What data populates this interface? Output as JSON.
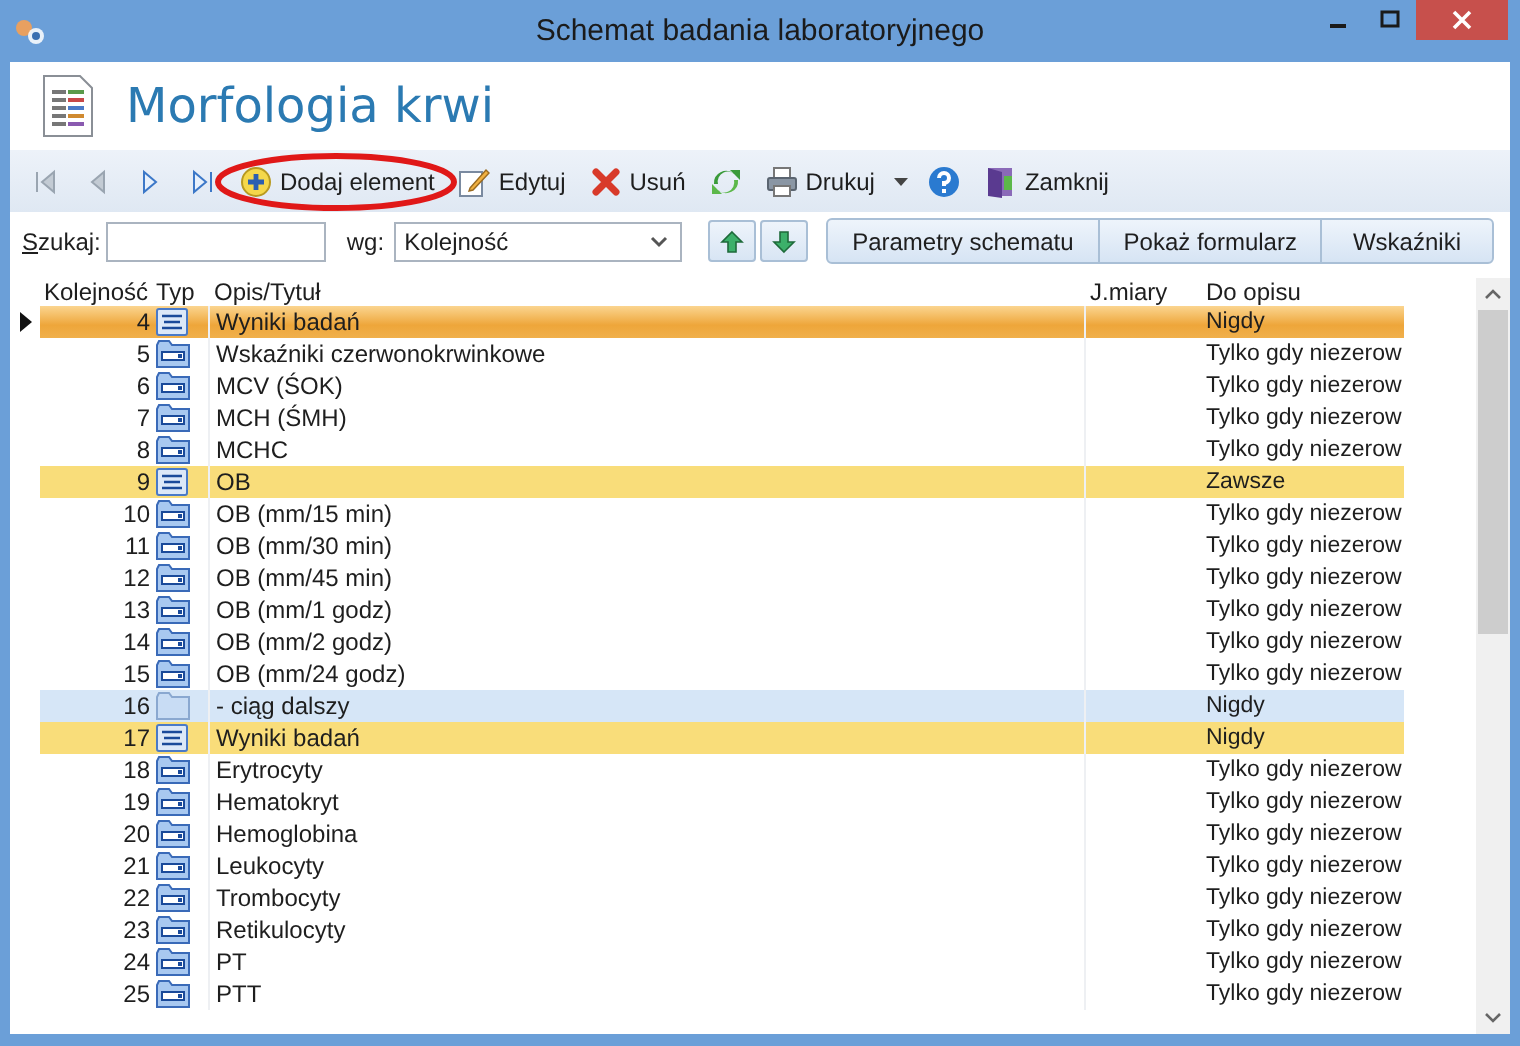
{
  "window": {
    "title": "Schemat badania laboratoryjnego"
  },
  "header": {
    "title": "Morfologia krwi"
  },
  "toolbar": [
    {
      "kind": "first",
      "disabled": true
    },
    {
      "kind": "prev",
      "disabled": true
    },
    {
      "kind": "next",
      "disabled": false
    },
    {
      "kind": "last",
      "disabled": false
    },
    {
      "kind": "add",
      "label": "Dodaj element",
      "circled": true
    },
    {
      "kind": "edit",
      "label": "Edytuj"
    },
    {
      "kind": "delete",
      "label": "Usuń"
    },
    {
      "kind": "refresh"
    },
    {
      "kind": "print",
      "label": "Drukuj"
    },
    {
      "kind": "dropdown"
    },
    {
      "kind": "help"
    },
    {
      "kind": "close",
      "label": "Zamknij"
    }
  ],
  "search": {
    "label": "Szukaj:"
  },
  "sort": {
    "label": "wg:",
    "value": "Kolejność"
  },
  "move_buttons": [
    {
      "kind": "up"
    },
    {
      "kind": "down"
    }
  ],
  "buttons": [
    "Parametry schematu",
    "Pokaż formularz",
    "Wskaźniki"
  ],
  "table": {
    "columns": [
      "Kolejność",
      "Typ",
      "Opis/Tytuł",
      "J.miary",
      "Do opisu"
    ],
    "rows": [
      {
        "order": "4",
        "kind": "group",
        "title": "Wyniki badań",
        "mode": "Nigdy",
        "selected": true
      },
      {
        "order": "5",
        "kind": "item",
        "title": "Wskaźniki czerwonokrwinkowe",
        "mode": "Tylko gdy niezerow",
        "selected": false
      },
      {
        "order": "6",
        "kind": "item",
        "title": "MCV (ŚOK)",
        "mode": "Tylko gdy niezerow",
        "selected": false
      },
      {
        "order": "7",
        "kind": "item",
        "title": "MCH (ŚMH)",
        "mode": "Tylko gdy niezerow",
        "selected": false
      },
      {
        "order": "8",
        "kind": "item",
        "title": "MCHC",
        "mode": "Tylko gdy niezerow",
        "selected": false
      },
      {
        "order": "9",
        "kind": "group",
        "title": "OB",
        "mode": "Zawsze",
        "selected": false
      },
      {
        "order": "10",
        "kind": "item",
        "title": "OB (mm/15 min)",
        "mode": "Tylko gdy niezerow",
        "selected": false
      },
      {
        "order": "11",
        "kind": "item",
        "title": "OB (mm/30 min)",
        "mode": "Tylko gdy niezerow",
        "selected": false
      },
      {
        "order": "12",
        "kind": "item",
        "title": "OB (mm/45 min)",
        "mode": "Tylko gdy niezerow",
        "selected": false
      },
      {
        "order": "13",
        "kind": "item",
        "title": "OB (mm/1 godz)",
        "mode": "Tylko gdy niezerow",
        "selected": false
      },
      {
        "order": "14",
        "kind": "item",
        "title": "OB (mm/2 godz)",
        "mode": "Tylko gdy niezerow",
        "selected": false
      },
      {
        "order": "15",
        "kind": "item",
        "title": "OB (mm/24 godz)",
        "mode": "Tylko gdy niezerow",
        "selected": false
      },
      {
        "order": "16",
        "kind": "continuation",
        "title": "- ciąg dalszy",
        "mode": "Nigdy",
        "selected": false
      },
      {
        "order": "17",
        "kind": "group",
        "title": "Wyniki badań",
        "mode": "Nigdy",
        "selected": false
      },
      {
        "order": "18",
        "kind": "item",
        "title": "Erytrocyty",
        "mode": "Tylko gdy niezerow",
        "selected": false
      },
      {
        "order": "19",
        "kind": "item",
        "title": "Hematokryt",
        "mode": "Tylko gdy niezerow",
        "selected": false
      },
      {
        "order": "20",
        "kind": "item",
        "title": "Hemoglobina",
        "mode": "Tylko gdy niezerow",
        "selected": false
      },
      {
        "order": "21",
        "kind": "item",
        "title": "Leukocyty",
        "mode": "Tylko gdy niezerow",
        "selected": false
      },
      {
        "order": "22",
        "kind": "item",
        "title": "Trombocyty",
        "mode": "Tylko gdy niezerow",
        "selected": false
      },
      {
        "order": "23",
        "kind": "item",
        "title": "Retikulocyty",
        "mode": "Tylko gdy niezerow",
        "selected": false
      },
      {
        "order": "24",
        "kind": "item",
        "title": "PT",
        "mode": "Tylko gdy niezerow",
        "selected": false
      },
      {
        "order": "25",
        "kind": "item",
        "title": "PTT",
        "mode": "Tylko gdy niezerow",
        "selected": false
      }
    ]
  }
}
